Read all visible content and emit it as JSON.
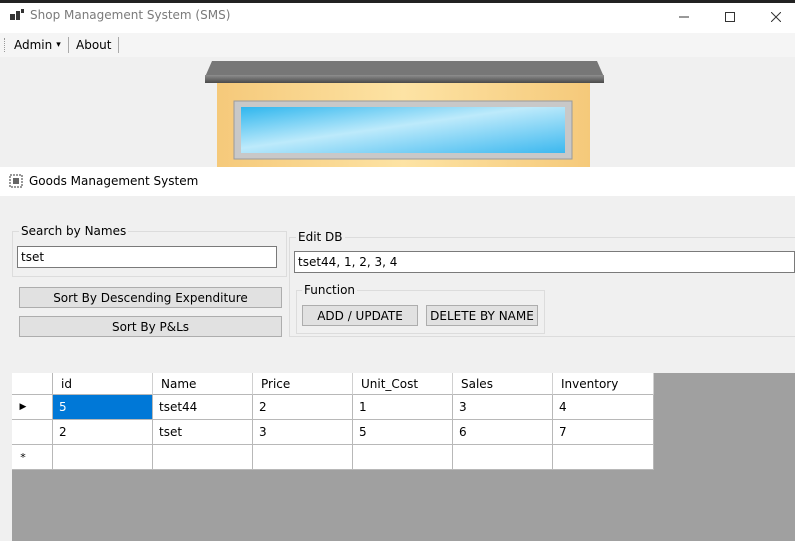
{
  "window": {
    "title": "Shop Management System (SMS)",
    "minimize_glyph": "—",
    "maximize_glyph": "☐",
    "close_glyph": "✕"
  },
  "menu": {
    "items": [
      {
        "label": "Admin",
        "has_dropdown": true
      },
      {
        "label": "About",
        "has_dropdown": false
      }
    ],
    "dropdown_glyph": "▾"
  },
  "child_window": {
    "title": "Goods Management System"
  },
  "search": {
    "group_label": "Search by Names",
    "value": "tset"
  },
  "buttons": {
    "sort_expenditure": "Sort By Descending Expenditure",
    "sort_pnl": "Sort By P&Ls",
    "add_update": "ADD / UPDATE",
    "delete_by_name": "DELETE BY NAME"
  },
  "edit_db": {
    "group_label": "Edit DB",
    "value": "tset44, 1, 2, 3, 4"
  },
  "function": {
    "group_label": "Function"
  },
  "table": {
    "columns": [
      "id",
      "Name",
      "Price",
      "Unit_Cost",
      "Sales",
      "Inventory"
    ],
    "rows": [
      [
        "5",
        "tset44",
        "2",
        "1",
        "3",
        "4"
      ],
      [
        "2",
        "tset",
        "3",
        "5",
        "6",
        "7"
      ]
    ],
    "current_row_glyph": "▶",
    "new_row_glyph": "*"
  },
  "colors": {
    "selection": "#0078d7",
    "grid_background": "#a0a0a0",
    "storefront_wall": "#fddc93",
    "storefront_glass": "#5dc8f0"
  }
}
